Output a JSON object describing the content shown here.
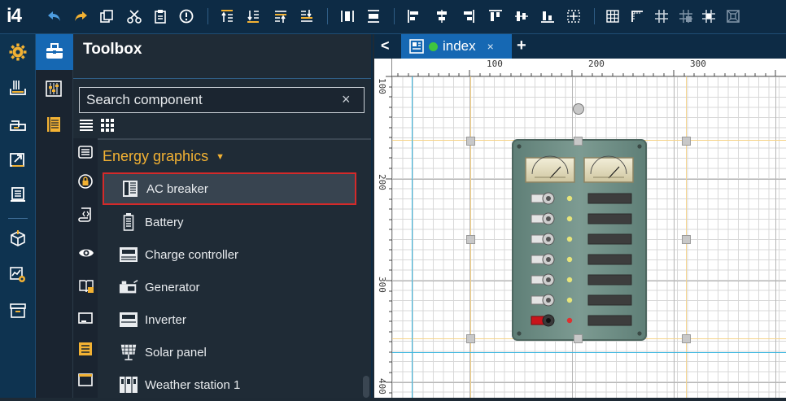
{
  "app": {
    "logo": "i4"
  },
  "toolbox": {
    "title": "Toolbox",
    "search_placeholder": "Search component",
    "clear_symbol": "×",
    "category": "Energy graphics",
    "items": [
      {
        "label": "AC breaker",
        "icon": "ac-breaker-icon",
        "selected": true
      },
      {
        "label": "Battery",
        "icon": "battery-icon"
      },
      {
        "label": "Charge controller",
        "icon": "charge-controller-icon"
      },
      {
        "label": "Generator",
        "icon": "generator-icon"
      },
      {
        "label": "Inverter",
        "icon": "inverter-icon"
      },
      {
        "label": "Solar panel",
        "icon": "solar-panel-icon"
      },
      {
        "label": "Weather station 1",
        "icon": "weather-station-icon"
      }
    ]
  },
  "tabs": {
    "back_symbol": "<",
    "active": {
      "label": "index",
      "close": "×",
      "status_color": "#3fc53f"
    },
    "add_symbol": "+"
  },
  "rulers": {
    "top_labels": [
      "100",
      "200",
      "300"
    ],
    "left_labels": [
      "100",
      "200",
      "300",
      "400"
    ]
  },
  "colors": {
    "toolbar_bg": "#0d2b45",
    "accent_orange": "#f3b233",
    "selection_red": "#d42a2a",
    "tab_blue": "#1668b3",
    "guide_orange": "#f6d48a",
    "guide_cyan": "#38b6e0"
  }
}
